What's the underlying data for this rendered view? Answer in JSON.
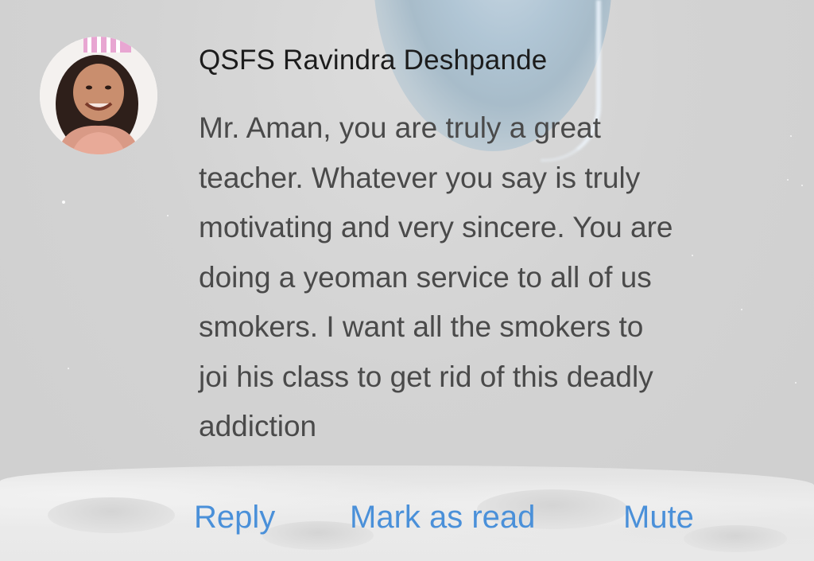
{
  "notification": {
    "sender": "QSFS Ravindra Deshpande",
    "message_lines": [
      "Mr. Aman, you are truly a great",
      "teacher. Whatever you say is truly",
      "motivating and very sincere. You are",
      "doing a yeoman service to all of us",
      "smokers. I want all the smokers to",
      "joi his class to get rid of this deadly",
      "addiction"
    ],
    "avatar_icon": "avatar-photo",
    "actions": {
      "reply_label": "Reply",
      "mark_read_label": "Mark as read",
      "mute_label": "Mute"
    },
    "colors": {
      "action": "#4a90d9",
      "sender": "#1c1c1c",
      "message": "#4a4a4a",
      "background": "#d3d3d3"
    }
  }
}
